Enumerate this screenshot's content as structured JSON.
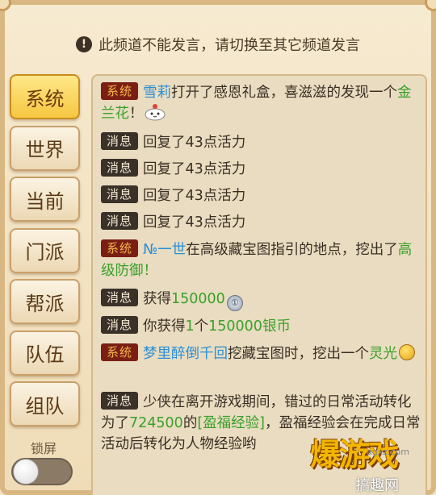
{
  "notice": {
    "icon": "exclamation-icon",
    "text": "此频道不能发言，请切换至其它频道发言"
  },
  "tabs": [
    {
      "label": "系统",
      "active": true
    },
    {
      "label": "世界"
    },
    {
      "label": "当前"
    },
    {
      "label": "门派"
    },
    {
      "label": "帮派"
    },
    {
      "label": "队伍"
    },
    {
      "label": "组队"
    }
  ],
  "lock": {
    "label": "锁屏"
  },
  "tags": {
    "system": "系统",
    "info": "消息"
  },
  "messages": {
    "m1": {
      "name": "雪莉",
      "t1": "打开了感恩礼盒，喜滋滋的发现一个",
      "item": "金兰花",
      "t2": "！",
      "icon": "cloud-face-icon"
    },
    "m2": {
      "text": "回复了43点活力"
    },
    "m3": {
      "text": "回复了43点活力"
    },
    "m4": {
      "text": "回复了43点活力"
    },
    "m5": {
      "text": "回复了43点活力"
    },
    "m6": {
      "name": "№一世",
      "t1": "在高级藏宝图指引的地点，挖出了",
      "item": "高级防御！"
    },
    "m7": {
      "t1": "获得",
      "amount": "150000",
      "icon": "silver-coin-icon"
    },
    "m8": {
      "t1": "你获得",
      "count": "1",
      "t2": "个",
      "item": "150000银币"
    },
    "m9": {
      "name": "梦里醉倒千回",
      "t1": "挖藏宝图时，挖出一个",
      "item": "灵光",
      "icon": "grin-face-icon"
    },
    "m10": {
      "t1": "少侠在离开游戏期间，错过的日常活动转化为了",
      "amount": "724500",
      "t2": "的",
      "item": "[盈福经验]",
      "t3": "，盈福经验会在完成日常活动后转化为人物经验哟"
    }
  },
  "watermark": {
    "logo": "爆游戏",
    "url": "agxz.com",
    "site": "搞趣网"
  },
  "colors": {
    "player_name": "#2b8fd6",
    "item_green": "#3aa02a",
    "system_tag_bg": "#7b1f14",
    "info_tag_bg": "#3a3129",
    "active_tab": "#f6c640"
  }
}
